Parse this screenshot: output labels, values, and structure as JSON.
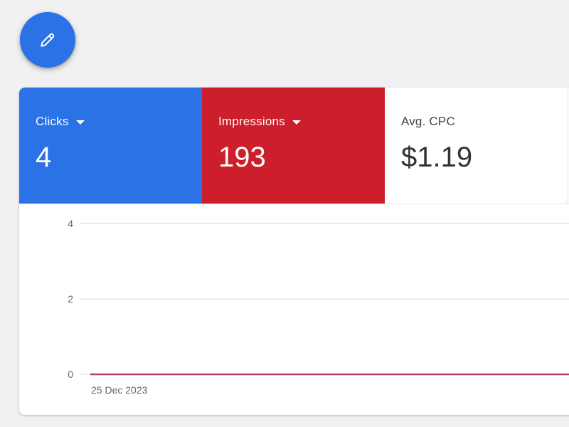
{
  "fab": {
    "icon": "pencil-icon"
  },
  "metrics": {
    "clicks": {
      "label": "Clicks",
      "value": "4",
      "color": "#2a72e6"
    },
    "impressions": {
      "label": "Impressions",
      "value": "193",
      "color": "#cd1e2b"
    },
    "avg_cpc": {
      "label": "Avg. CPC",
      "value": "$1.19"
    }
  },
  "chart_data": {
    "type": "line",
    "x": [
      "25 Dec 2023"
    ],
    "series": [
      {
        "values": [
          0
        ],
        "color": "#b04366"
      }
    ],
    "yticks": [
      "4",
      "2",
      "0"
    ],
    "ylim": [
      0,
      4
    ],
    "grid": true
  }
}
